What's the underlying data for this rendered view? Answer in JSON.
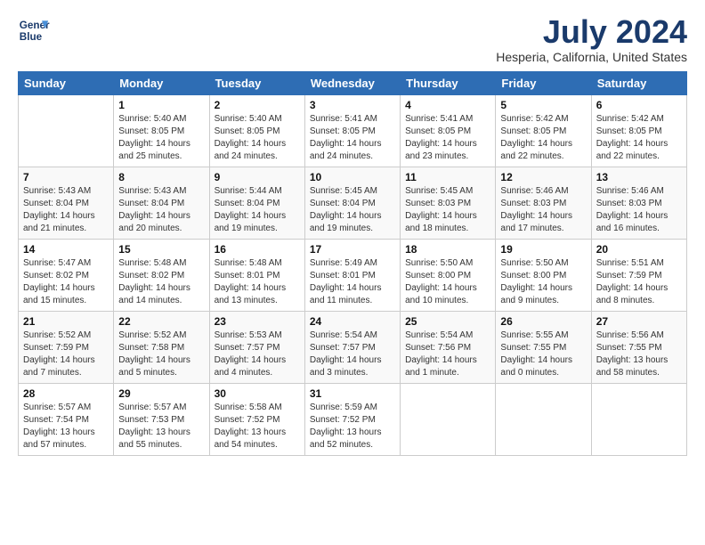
{
  "logo": {
    "line1": "General",
    "line2": "Blue"
  },
  "title": "July 2024",
  "subtitle": "Hesperia, California, United States",
  "days_of_week": [
    "Sunday",
    "Monday",
    "Tuesday",
    "Wednesday",
    "Thursday",
    "Friday",
    "Saturday"
  ],
  "weeks": [
    [
      {
        "day": "",
        "sunrise": "",
        "sunset": "",
        "daylight": ""
      },
      {
        "day": "1",
        "sunrise": "Sunrise: 5:40 AM",
        "sunset": "Sunset: 8:05 PM",
        "daylight": "Daylight: 14 hours and 25 minutes."
      },
      {
        "day": "2",
        "sunrise": "Sunrise: 5:40 AM",
        "sunset": "Sunset: 8:05 PM",
        "daylight": "Daylight: 14 hours and 24 minutes."
      },
      {
        "day": "3",
        "sunrise": "Sunrise: 5:41 AM",
        "sunset": "Sunset: 8:05 PM",
        "daylight": "Daylight: 14 hours and 24 minutes."
      },
      {
        "day": "4",
        "sunrise": "Sunrise: 5:41 AM",
        "sunset": "Sunset: 8:05 PM",
        "daylight": "Daylight: 14 hours and 23 minutes."
      },
      {
        "day": "5",
        "sunrise": "Sunrise: 5:42 AM",
        "sunset": "Sunset: 8:05 PM",
        "daylight": "Daylight: 14 hours and 22 minutes."
      },
      {
        "day": "6",
        "sunrise": "Sunrise: 5:42 AM",
        "sunset": "Sunset: 8:05 PM",
        "daylight": "Daylight: 14 hours and 22 minutes."
      }
    ],
    [
      {
        "day": "7",
        "sunrise": "Sunrise: 5:43 AM",
        "sunset": "Sunset: 8:04 PM",
        "daylight": "Daylight: 14 hours and 21 minutes."
      },
      {
        "day": "8",
        "sunrise": "Sunrise: 5:43 AM",
        "sunset": "Sunset: 8:04 PM",
        "daylight": "Daylight: 14 hours and 20 minutes."
      },
      {
        "day": "9",
        "sunrise": "Sunrise: 5:44 AM",
        "sunset": "Sunset: 8:04 PM",
        "daylight": "Daylight: 14 hours and 19 minutes."
      },
      {
        "day": "10",
        "sunrise": "Sunrise: 5:45 AM",
        "sunset": "Sunset: 8:04 PM",
        "daylight": "Daylight: 14 hours and 19 minutes."
      },
      {
        "day": "11",
        "sunrise": "Sunrise: 5:45 AM",
        "sunset": "Sunset: 8:03 PM",
        "daylight": "Daylight: 14 hours and 18 minutes."
      },
      {
        "day": "12",
        "sunrise": "Sunrise: 5:46 AM",
        "sunset": "Sunset: 8:03 PM",
        "daylight": "Daylight: 14 hours and 17 minutes."
      },
      {
        "day": "13",
        "sunrise": "Sunrise: 5:46 AM",
        "sunset": "Sunset: 8:03 PM",
        "daylight": "Daylight: 14 hours and 16 minutes."
      }
    ],
    [
      {
        "day": "14",
        "sunrise": "Sunrise: 5:47 AM",
        "sunset": "Sunset: 8:02 PM",
        "daylight": "Daylight: 14 hours and 15 minutes."
      },
      {
        "day": "15",
        "sunrise": "Sunrise: 5:48 AM",
        "sunset": "Sunset: 8:02 PM",
        "daylight": "Daylight: 14 hours and 14 minutes."
      },
      {
        "day": "16",
        "sunrise": "Sunrise: 5:48 AM",
        "sunset": "Sunset: 8:01 PM",
        "daylight": "Daylight: 14 hours and 13 minutes."
      },
      {
        "day": "17",
        "sunrise": "Sunrise: 5:49 AM",
        "sunset": "Sunset: 8:01 PM",
        "daylight": "Daylight: 14 hours and 11 minutes."
      },
      {
        "day": "18",
        "sunrise": "Sunrise: 5:50 AM",
        "sunset": "Sunset: 8:00 PM",
        "daylight": "Daylight: 14 hours and 10 minutes."
      },
      {
        "day": "19",
        "sunrise": "Sunrise: 5:50 AM",
        "sunset": "Sunset: 8:00 PM",
        "daylight": "Daylight: 14 hours and 9 minutes."
      },
      {
        "day": "20",
        "sunrise": "Sunrise: 5:51 AM",
        "sunset": "Sunset: 7:59 PM",
        "daylight": "Daylight: 14 hours and 8 minutes."
      }
    ],
    [
      {
        "day": "21",
        "sunrise": "Sunrise: 5:52 AM",
        "sunset": "Sunset: 7:59 PM",
        "daylight": "Daylight: 14 hours and 7 minutes."
      },
      {
        "day": "22",
        "sunrise": "Sunrise: 5:52 AM",
        "sunset": "Sunset: 7:58 PM",
        "daylight": "Daylight: 14 hours and 5 minutes."
      },
      {
        "day": "23",
        "sunrise": "Sunrise: 5:53 AM",
        "sunset": "Sunset: 7:57 PM",
        "daylight": "Daylight: 14 hours and 4 minutes."
      },
      {
        "day": "24",
        "sunrise": "Sunrise: 5:54 AM",
        "sunset": "Sunset: 7:57 PM",
        "daylight": "Daylight: 14 hours and 3 minutes."
      },
      {
        "day": "25",
        "sunrise": "Sunrise: 5:54 AM",
        "sunset": "Sunset: 7:56 PM",
        "daylight": "Daylight: 14 hours and 1 minute."
      },
      {
        "day": "26",
        "sunrise": "Sunrise: 5:55 AM",
        "sunset": "Sunset: 7:55 PM",
        "daylight": "Daylight: 14 hours and 0 minutes."
      },
      {
        "day": "27",
        "sunrise": "Sunrise: 5:56 AM",
        "sunset": "Sunset: 7:55 PM",
        "daylight": "Daylight: 13 hours and 58 minutes."
      }
    ],
    [
      {
        "day": "28",
        "sunrise": "Sunrise: 5:57 AM",
        "sunset": "Sunset: 7:54 PM",
        "daylight": "Daylight: 13 hours and 57 minutes."
      },
      {
        "day": "29",
        "sunrise": "Sunrise: 5:57 AM",
        "sunset": "Sunset: 7:53 PM",
        "daylight": "Daylight: 13 hours and 55 minutes."
      },
      {
        "day": "30",
        "sunrise": "Sunrise: 5:58 AM",
        "sunset": "Sunset: 7:52 PM",
        "daylight": "Daylight: 13 hours and 54 minutes."
      },
      {
        "day": "31",
        "sunrise": "Sunrise: 5:59 AM",
        "sunset": "Sunset: 7:52 PM",
        "daylight": "Daylight: 13 hours and 52 minutes."
      },
      {
        "day": "",
        "sunrise": "",
        "sunset": "",
        "daylight": ""
      },
      {
        "day": "",
        "sunrise": "",
        "sunset": "",
        "daylight": ""
      },
      {
        "day": "",
        "sunrise": "",
        "sunset": "",
        "daylight": ""
      }
    ]
  ]
}
